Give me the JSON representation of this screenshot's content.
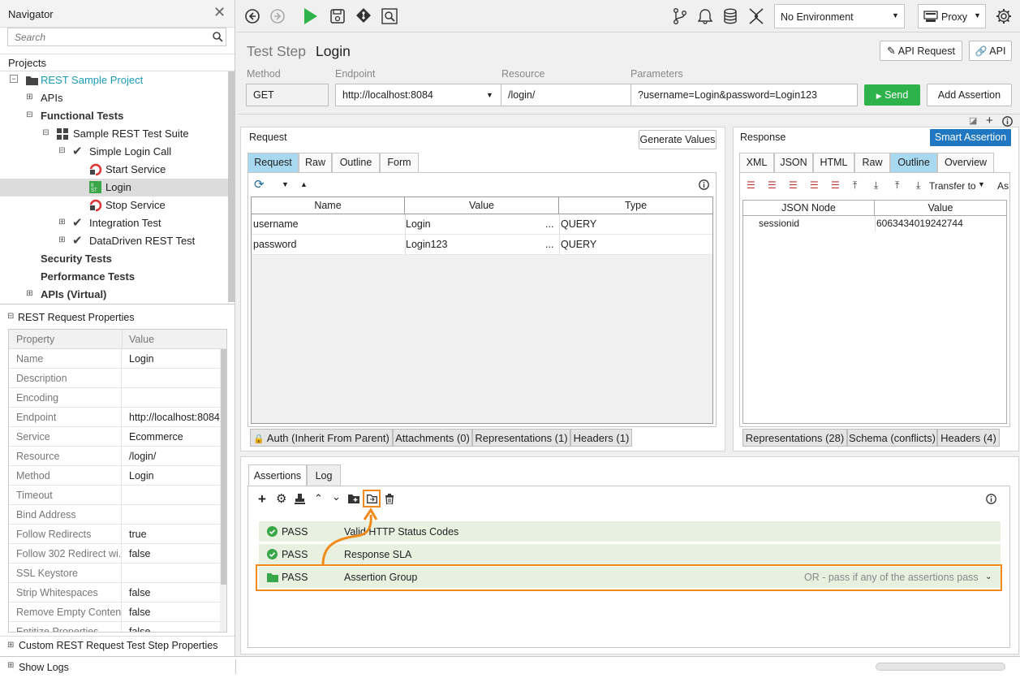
{
  "navigator": {
    "title": "Navigator",
    "search_placeholder": "Search",
    "projects_label": "Projects",
    "tree": [
      {
        "label": "REST Sample Project"
      },
      {
        "label": "APIs"
      },
      {
        "label": "Functional Tests"
      },
      {
        "label": "Sample REST Test Suite"
      },
      {
        "label": "Simple Login Call"
      },
      {
        "label": "Start Service"
      },
      {
        "label": "Login"
      },
      {
        "label": "Stop Service"
      },
      {
        "label": "Integration Test"
      },
      {
        "label": "DataDriven REST Test"
      },
      {
        "label": "Security Tests"
      },
      {
        "label": "Performance Tests"
      },
      {
        "label": "APIs (Virtual)"
      }
    ]
  },
  "properties": {
    "title": "REST Request Properties",
    "col_property": "Property",
    "col_value": "Value",
    "rows": [
      {
        "k": "Name",
        "v": "Login"
      },
      {
        "k": "Description",
        "v": ""
      },
      {
        "k": "Encoding",
        "v": ""
      },
      {
        "k": "Endpoint",
        "v": "http://localhost:8084"
      },
      {
        "k": "Service",
        "v": "Ecommerce"
      },
      {
        "k": "Resource",
        "v": "/login/"
      },
      {
        "k": "Method",
        "v": "Login"
      },
      {
        "k": "Timeout",
        "v": ""
      },
      {
        "k": "Bind Address",
        "v": ""
      },
      {
        "k": "Follow Redirects",
        "v": "true"
      },
      {
        "k": "Follow 302 Redirect wi...",
        "v": "false"
      },
      {
        "k": "SSL Keystore",
        "v": ""
      },
      {
        "k": "Strip Whitespaces",
        "v": "false"
      },
      {
        "k": "Remove Empty Content",
        "v": "false"
      },
      {
        "k": "Entitize Properties",
        "v": "false"
      }
    ],
    "custom_label": "Custom REST Request Test Step Properties"
  },
  "statusbar": {
    "show_logs": "Show Logs"
  },
  "toolbar": {
    "environment": "No Environment",
    "proxy": "Proxy"
  },
  "step": {
    "prefix": "Test Step",
    "name": "Login",
    "api_request_btn": "API Request",
    "api_btn": "API",
    "method_label": "Method",
    "method": "GET",
    "endpoint_label": "Endpoint",
    "endpoint": "http://localhost:8084",
    "resource_label": "Resource",
    "resource": "/login/",
    "params_label": "Parameters",
    "params": "?username=Login&password=Login123",
    "send_btn": "Send",
    "add_assertion_btn": "Add Assertion"
  },
  "request": {
    "title": "Request",
    "generate_btn": "Generate Values",
    "tabs": [
      "Request",
      "Raw",
      "Outline",
      "Form"
    ],
    "columns": [
      "Name",
      "Value",
      "Type"
    ],
    "rows": [
      {
        "name": "username",
        "value": "Login",
        "more": "...",
        "type": "QUERY"
      },
      {
        "name": "password",
        "value": "Login123",
        "more": "...",
        "type": "QUERY"
      }
    ],
    "bottom_tabs": [
      "Auth (Inherit From Parent)",
      "Attachments (0)",
      "Representations (1)",
      "Headers (1)"
    ]
  },
  "response": {
    "title": "Response",
    "smart_btn": "Smart Assertion",
    "tabs": [
      "XML",
      "JSON",
      "HTML",
      "Raw",
      "Outline",
      "Overview"
    ],
    "transfer_to": "Transfer to",
    "as_label": "As",
    "columns": [
      "JSON Node",
      "Value"
    ],
    "rows": [
      {
        "node": "sessionid",
        "value": "6063434019242744"
      }
    ],
    "bottom_tabs": [
      "Representations (28)",
      "Schema (conflicts)",
      "Headers (4)"
    ]
  },
  "assertions": {
    "tabs": [
      "Assertions",
      "Log"
    ],
    "rows": [
      {
        "status": "PASS",
        "name": "Valid HTTP Status Codes",
        "note": ""
      },
      {
        "status": "PASS",
        "name": "Response SLA",
        "note": ""
      },
      {
        "status": "PASS",
        "name": "Assertion Group",
        "note": "OR - pass if any of the assertions pass"
      }
    ]
  },
  "colors": {
    "accent_teal": "#1a9bb4",
    "send_green": "#2eb24a",
    "smart_blue": "#1f77c2",
    "highlight_orange": "#f08a1a",
    "tab_active": "#a9d9f0",
    "pass_green": "#3aa64a"
  }
}
